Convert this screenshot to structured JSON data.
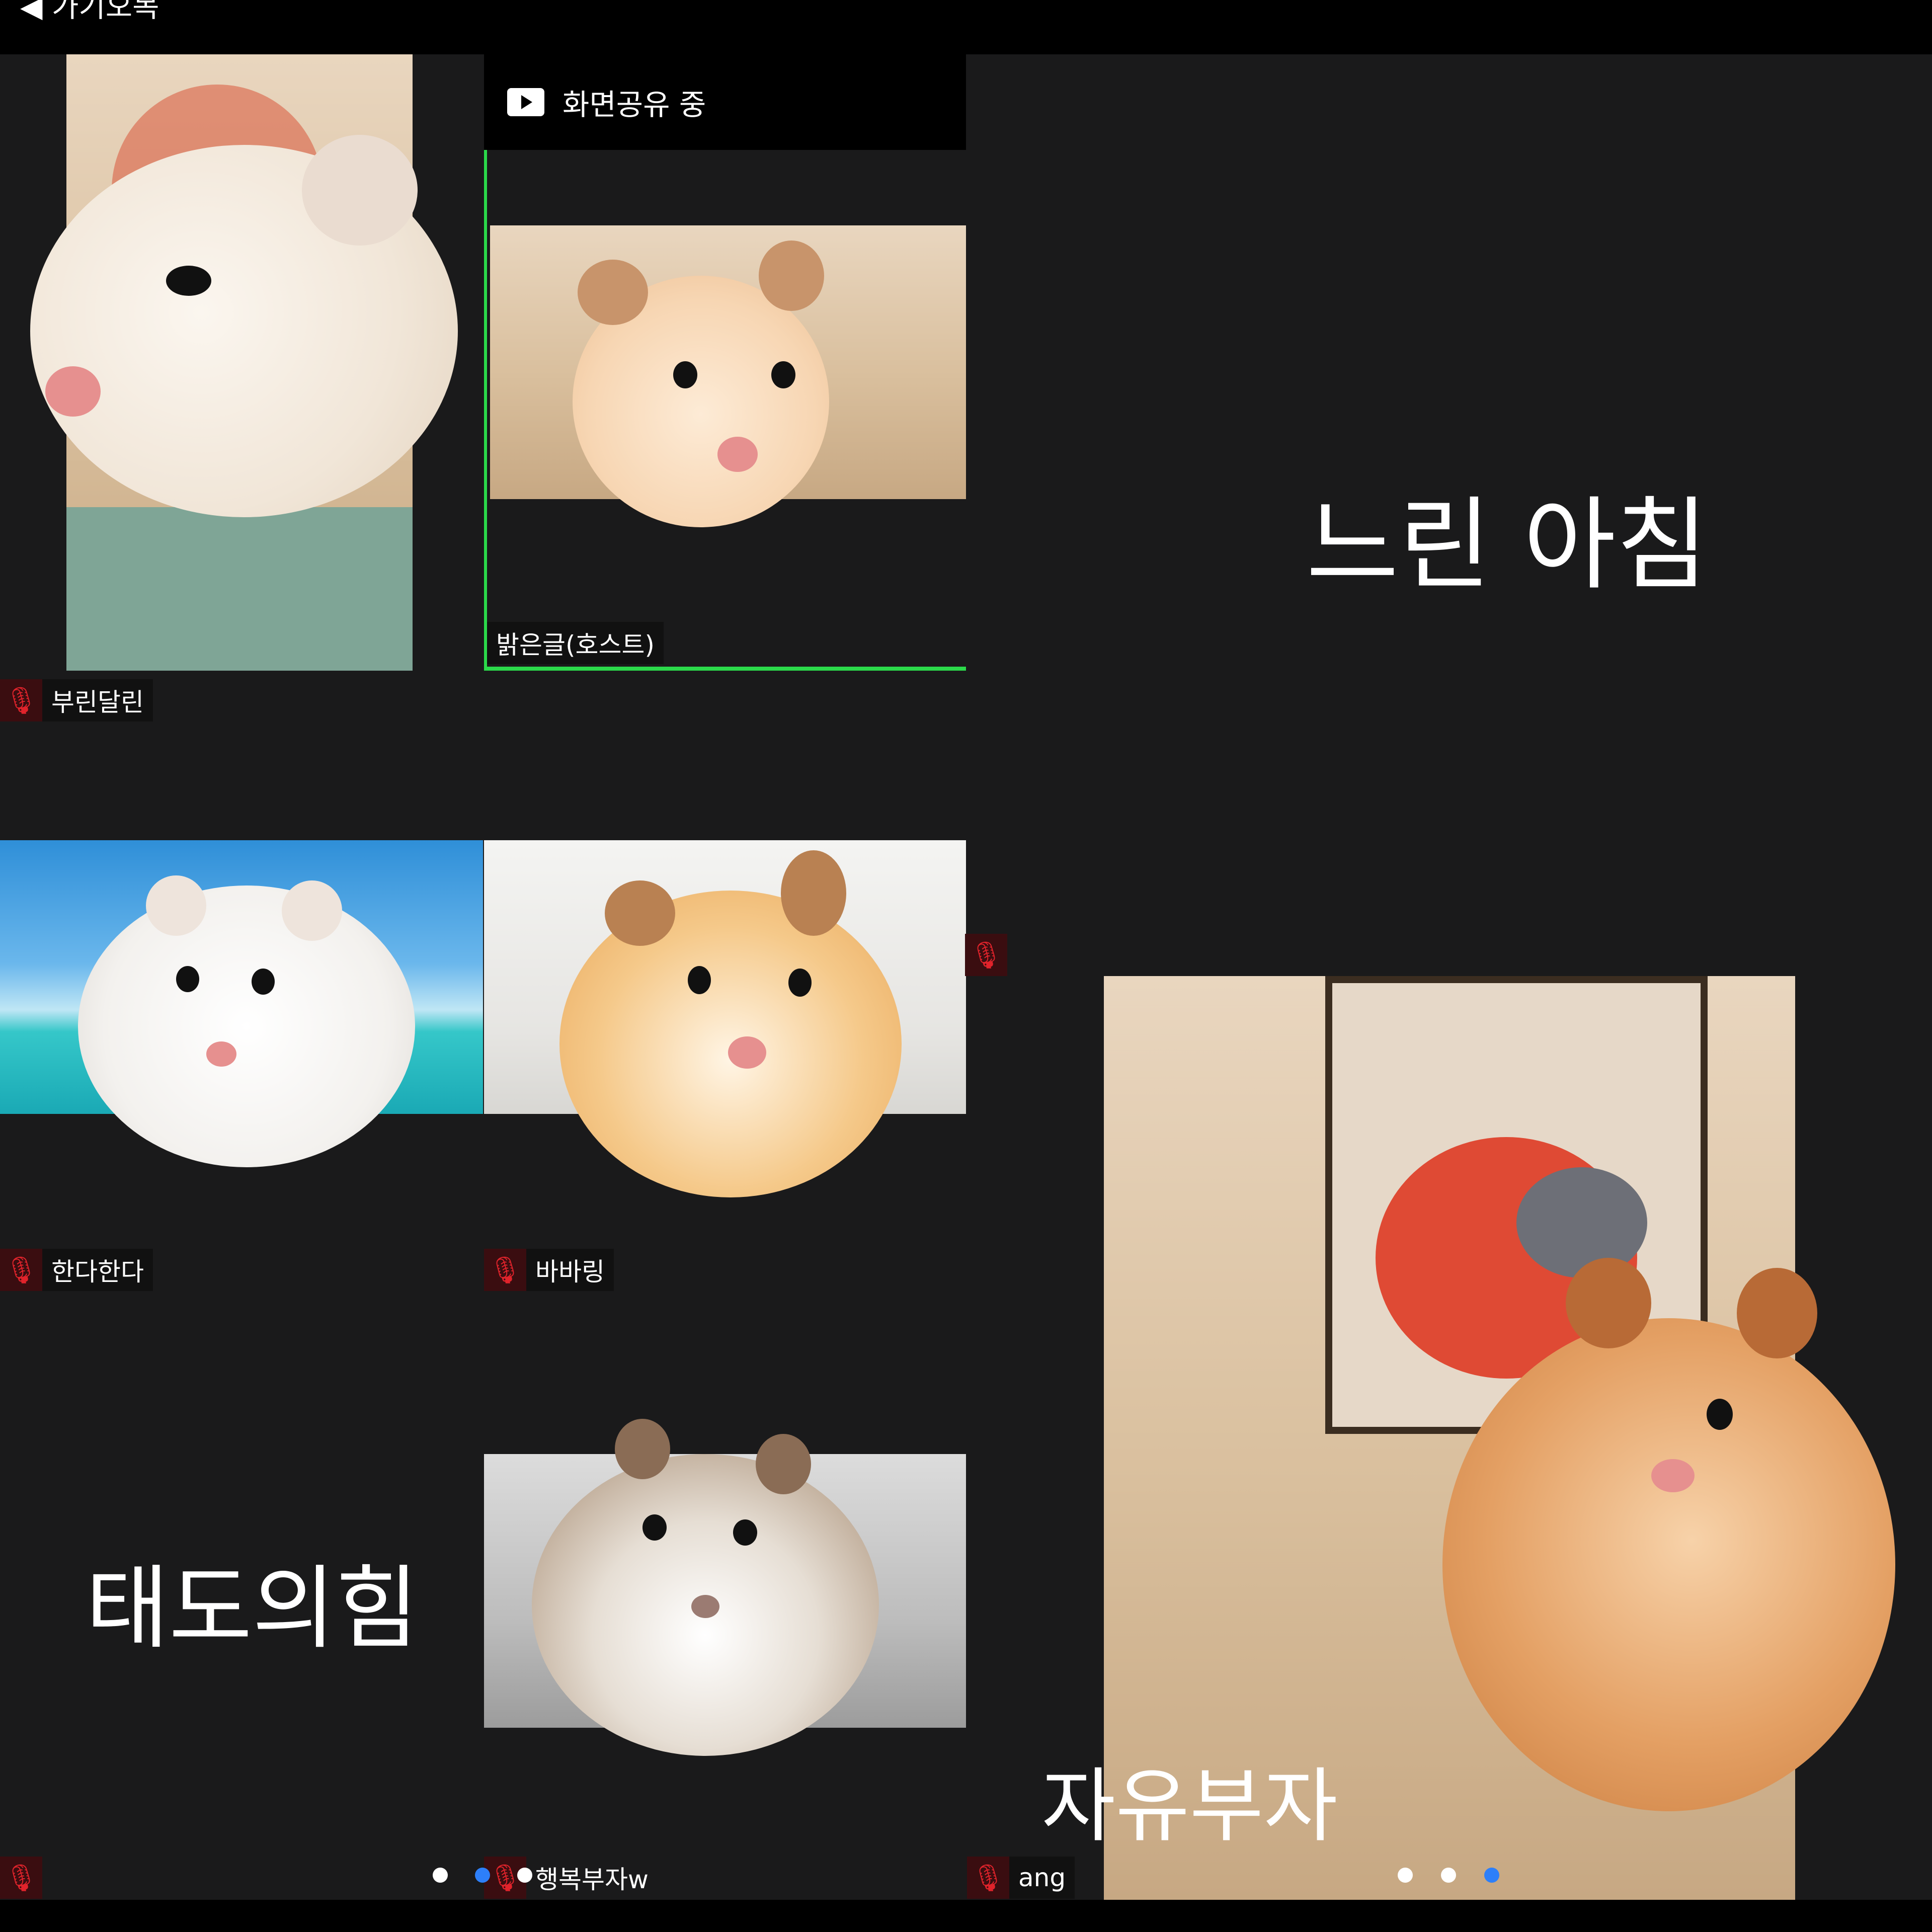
{
  "topbar": {
    "back_label": "◀ 가기오목"
  },
  "share_banner": {
    "text": "화면공유 중"
  },
  "participants": [
    {
      "name": "부린달린",
      "muted": true
    },
    {
      "name": "밝은글(호스트)",
      "muted": false,
      "host": true
    },
    {
      "name": "한다한다",
      "muted": true
    },
    {
      "name": "바바링",
      "muted": true
    },
    {
      "name": "",
      "muted": true
    },
    {
      "name": "행복부자w",
      "muted": true
    },
    {
      "name": "ang",
      "muted": true
    }
  ],
  "overlay_texts": {
    "slow_morning": "느린 아침",
    "attitude": "태도의힘",
    "rich_freedom": "자유부자"
  },
  "pagination": {
    "left_dots": 3,
    "left_active": 1,
    "right_dots": 3,
    "right_active": 2
  },
  "colors": {
    "background": "#1a1a1b",
    "host_border": "#2bd94a",
    "muted_icon": "#e0232b",
    "active_dot": "#2d7ff9"
  }
}
